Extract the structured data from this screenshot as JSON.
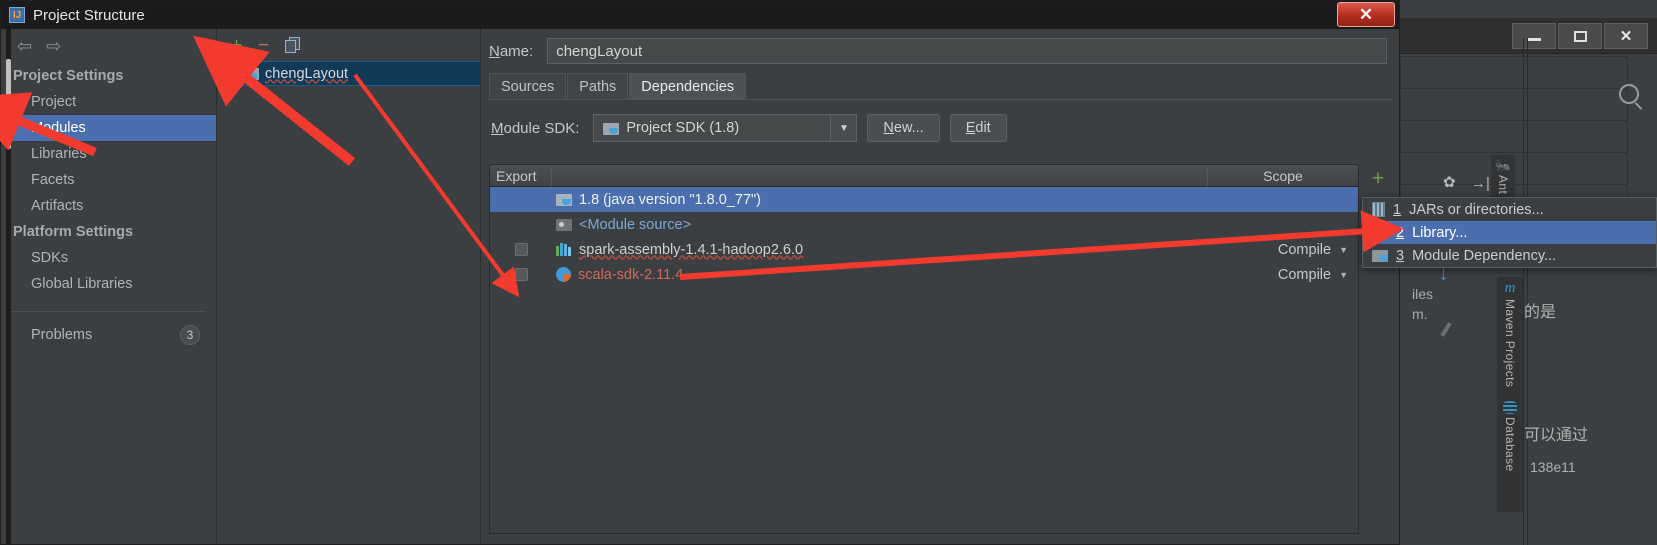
{
  "dialog": {
    "title": "Project Structure",
    "icon": "idea-logo-icon",
    "close_label": "✕"
  },
  "sidebar": {
    "back_icon": "◀",
    "forward_icon": "▶",
    "groups": [
      {
        "header": "Project Settings",
        "items": [
          "Project",
          "Modules",
          "Libraries",
          "Facets",
          "Artifacts"
        ]
      },
      {
        "header": "Platform Settings",
        "items": [
          "SDKs",
          "Global Libraries"
        ]
      }
    ],
    "selected": "Modules",
    "problems": {
      "label": "Problems",
      "count": "3"
    }
  },
  "modules_panel": {
    "toolbar": {
      "add": "+",
      "remove": "−",
      "copy": "copy-icon"
    },
    "items": [
      {
        "name": "chengLayout",
        "selected": true
      }
    ]
  },
  "detail": {
    "name_label": "Name:",
    "name_value": "chengLayout",
    "tabs": [
      {
        "label": "Sources",
        "active": false
      },
      {
        "label": "Paths",
        "active": false
      },
      {
        "label": "Dependencies",
        "active": true
      }
    ],
    "sdk_label": "Module SDK:",
    "sdk_value": "Project SDK (1.8)",
    "new_button": "New...",
    "edit_button": "Edit",
    "table": {
      "headers": {
        "export": "Export",
        "scope": "Scope"
      },
      "rows": [
        {
          "checkbox": false,
          "show_checkbox": false,
          "icon": "jdk-icon",
          "label": "1.8 (java version \"1.8.0_77\")",
          "style": "white",
          "scope": "",
          "selected": true
        },
        {
          "checkbox": false,
          "show_checkbox": false,
          "icon": "module-source-icon",
          "label": "<Module source>",
          "style": "blue",
          "scope": "",
          "selected": false
        },
        {
          "checkbox": false,
          "show_checkbox": true,
          "icon": "library-icon",
          "label": "spark-assembly-1.4.1-hadoop2.6.0",
          "style": "norm",
          "scope": "Compile",
          "selected": false
        },
        {
          "checkbox": false,
          "show_checkbox": true,
          "icon": "scala-sdk-icon",
          "label": "scala-sdk-2.11.4",
          "style": "red",
          "scope": "Compile",
          "selected": false
        }
      ]
    },
    "side_actions": {
      "add": "+",
      "move_down": "↓",
      "edit": "pencil-icon"
    }
  },
  "popup_menu": {
    "items": [
      {
        "num": "1",
        "label": "JARs or directories...",
        "icon": "jar-icon",
        "selected": false
      },
      {
        "num": "2",
        "label": "Library...",
        "icon": "library-icon",
        "selected": true
      },
      {
        "num": "3",
        "label": "Module Dependency...",
        "icon": "module-icon",
        "selected": false
      }
    ]
  },
  "background_ide": {
    "window_buttons": {
      "minimize": "—",
      "maximize": "▢",
      "close": "✕"
    },
    "search_icon": "search-icon",
    "gear_icon": "gear-icon",
    "collapse_icon": "→|",
    "vertical_tabs": [
      {
        "label": "Ant",
        "icon": "ant-icon"
      },
      {
        "label": "Maven Projects",
        "icon": "maven-icon"
      },
      {
        "label": "Database",
        "icon": "database-icon"
      }
    ],
    "text_fragments": [
      "iles",
      "m.",
      "的是",
      "可以通过",
      "138e11"
    ]
  },
  "colors": {
    "accent_blue": "#4b6eaf",
    "annotation_red": "#f23a2e",
    "panel_bg": "#3c3f41",
    "selected_row": "#4b6eaf",
    "green": "#6a9e4b"
  }
}
